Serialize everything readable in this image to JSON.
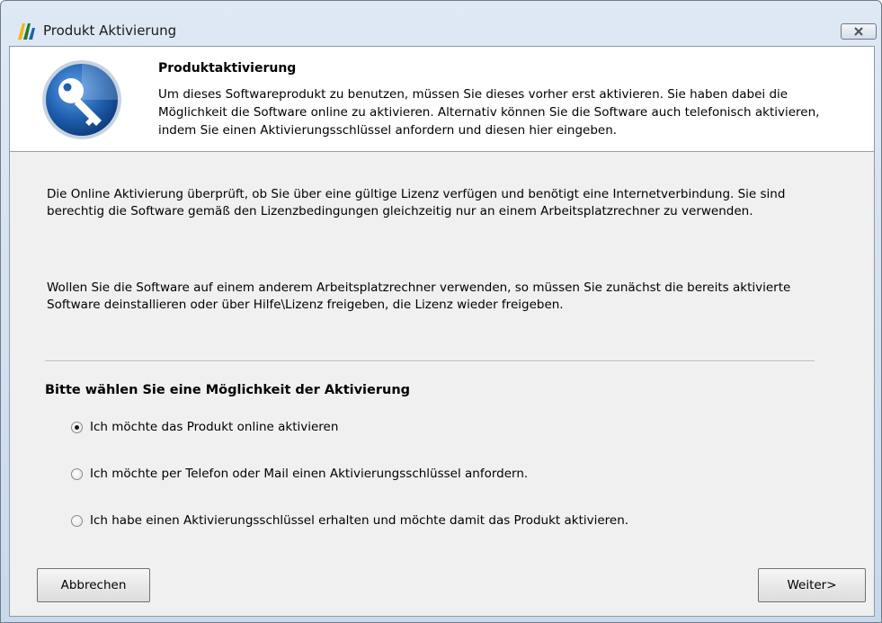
{
  "window": {
    "title": "Produkt Aktivierung"
  },
  "header": {
    "title": "Produktaktivierung",
    "description": "Um dieses Softwareprodukt zu benutzen, müssen Sie dieses vorher erst aktivieren. Sie haben dabei die Möglichkeit die Software online zu aktivieren. Alternativ können Sie die Software auch telefonisch aktivieren, indem Sie einen Aktivierungsschlüssel anfordern und diesen hier eingeben."
  },
  "body": {
    "paragraph1": "Die Online Aktivierung überprüft, ob Sie über eine gültige Lizenz verfügen und benötigt eine Internetverbindung. Sie sind berechtig die Software gemäß den Lizenzbedingungen gleichzeitig nur an einem Arbeitsplatzrechner zu verwenden.",
    "paragraph2": "Wollen Sie die Software auf einem anderem Arbeitsplatzrechner verwenden, so müssen Sie zunächst die bereits aktivierte Software deinstallieren oder über Hilfe\\Lizenz freigeben, die Lizenz wieder freigeben."
  },
  "options": {
    "section_title": "Bitte wählen Sie eine Möglichkeit der Aktivierung",
    "items": [
      {
        "label": "Ich möchte das Produkt online aktivieren",
        "selected": true
      },
      {
        "label": "Ich möchte per Telefon oder Mail einen Aktivierungsschlüssel anfordern.",
        "selected": false
      },
      {
        "label": "Ich habe einen Aktivierungsschlüssel erhalten und möchte damit das Produkt aktivieren.",
        "selected": false
      }
    ]
  },
  "buttons": {
    "cancel": "Abbrechen",
    "next": "Weiter>"
  },
  "icons": {
    "app": "app-logo-icon",
    "close": "close-icon",
    "header": "key-icon"
  },
  "colors": {
    "key_logo_blue": "#1f5fae",
    "window_frame": "#c9d9ec"
  }
}
